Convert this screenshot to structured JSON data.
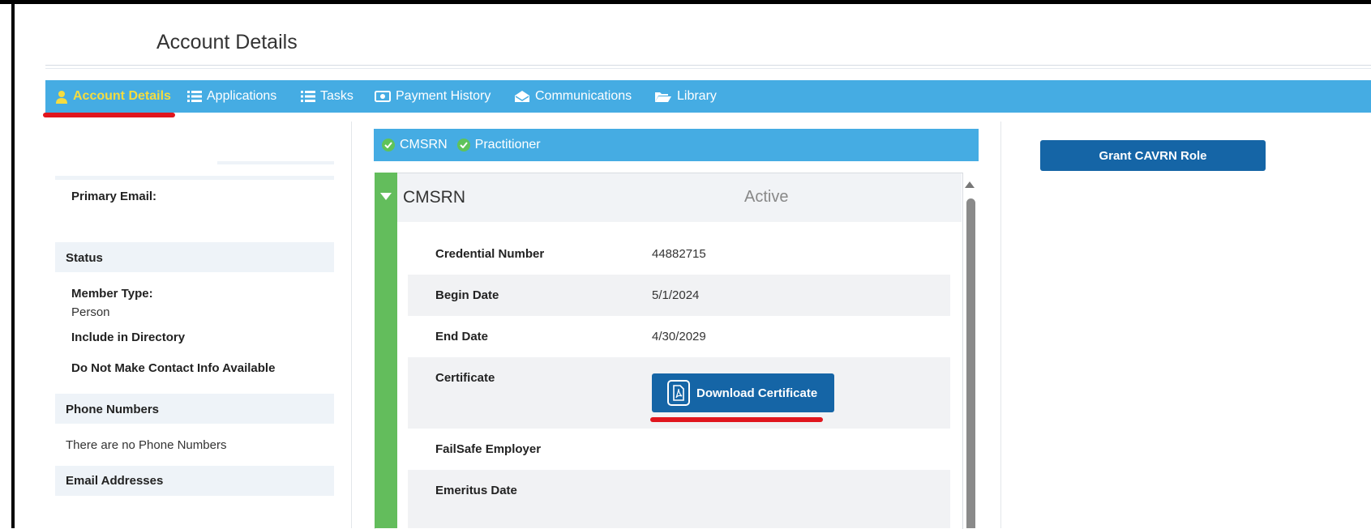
{
  "page": {
    "title": "Account Details"
  },
  "nav": {
    "items": [
      {
        "label": "Account Details",
        "icon": "user-icon",
        "active": true
      },
      {
        "label": "Applications",
        "icon": "list-icon",
        "active": false
      },
      {
        "label": "Tasks",
        "icon": "list-icon",
        "active": false
      },
      {
        "label": "Payment History",
        "icon": "money-icon",
        "active": false
      },
      {
        "label": "Communications",
        "icon": "envelope-open-icon",
        "active": false
      },
      {
        "label": "Library",
        "icon": "folder-icon",
        "active": false
      }
    ],
    "active_color": "#f5dc3f",
    "bar_color": "#45ace3"
  },
  "left": {
    "primary_email_label": "Primary Email:",
    "status_heading": "Status",
    "member_type_label": "Member Type:",
    "member_type_value": "Person",
    "include_directory_label": "Include in Directory",
    "no_contact_label": "Do Not Make Contact Info Available",
    "phone_heading": "Phone Numbers",
    "phone_empty": "There are no Phone Numbers",
    "email_heading": "Email Addresses"
  },
  "credentials": {
    "tags": [
      "CMSRN",
      "Practitioner"
    ],
    "panel": {
      "title": "CMSRN",
      "status": "Active",
      "rows": {
        "credential_number_label": "Credential Number",
        "credential_number_value": "44882715",
        "begin_date_label": "Begin Date",
        "begin_date_value": "5/1/2024",
        "end_date_label": "End Date",
        "end_date_value": "4/30/2029",
        "certificate_label": "Certificate",
        "download_label": "Download Certificate",
        "failsafe_label": "FailSafe Employer",
        "emeritus_label": "Emeritus Date"
      }
    }
  },
  "actions": {
    "grant_label": "Grant CAVRN Role"
  },
  "colors": {
    "primary_button": "#1565a6",
    "status_green": "#63bd5c",
    "annotation_red": "#e0161e"
  }
}
